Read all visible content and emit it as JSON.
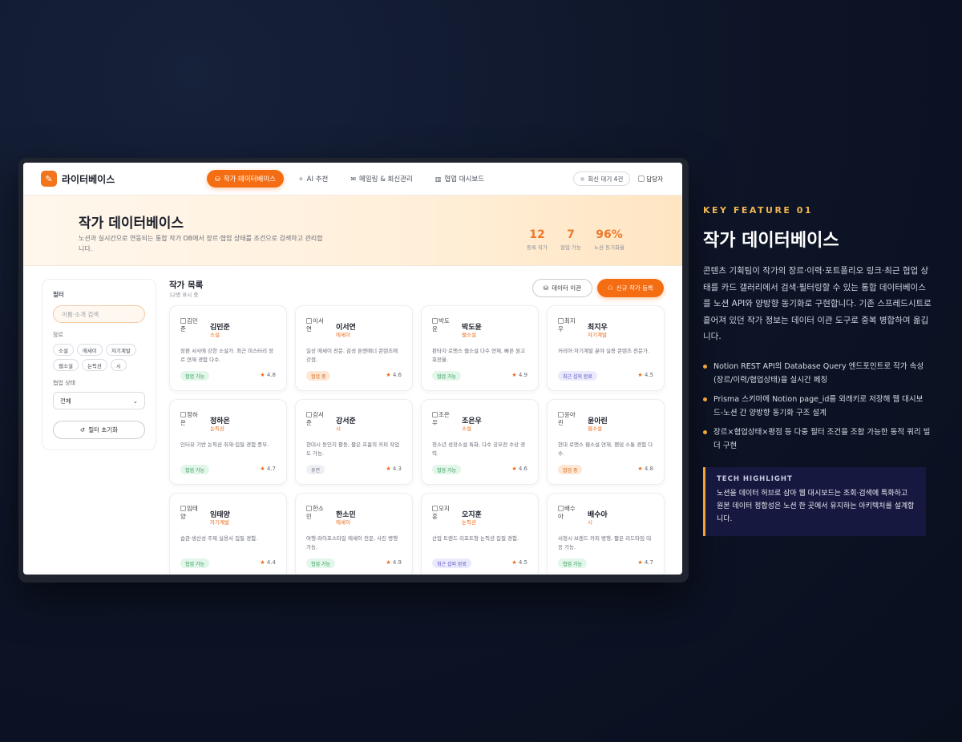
{
  "app": {
    "name": "라이터베이스"
  },
  "nav": {
    "items": [
      {
        "label": "작가 데이터베이스",
        "active": true
      },
      {
        "label": "AI 추천",
        "active": false
      },
      {
        "label": "메일링 & 회신관리",
        "active": false
      },
      {
        "label": "협업 대시보드",
        "active": false
      }
    ],
    "wait_pill": "회신 대기 4건",
    "user_alt": "담당자"
  },
  "hero": {
    "title": "작가 데이터베이스",
    "desc": "노션과 실시간으로 연동되는 통합 작가 DB에서 장르·협업 상태를 조건으로 검색하고 관리합니다.",
    "stats": [
      {
        "value": "12",
        "label": "등록 작가"
      },
      {
        "value": "7",
        "label": "협업 가능"
      },
      {
        "value": "96%",
        "label": "노션 동기화율"
      }
    ]
  },
  "filter": {
    "title": "필터",
    "search_placeholder": "이름·소개 검색",
    "genre_label": "장르",
    "genres": [
      "소설",
      "에세이",
      "자기계발",
      "웹소설",
      "논픽션",
      "시"
    ],
    "status_label": "협업 상태",
    "status_value": "전체",
    "reset_label": "필터 초기화"
  },
  "list": {
    "title": "작가 목록",
    "count": "12명 표시 중",
    "migrate_label": "데이터 이관",
    "new_label": "신규 작가 등록"
  },
  "authors": [
    {
      "alt1": "김민",
      "alt2": "준",
      "name": "김민준",
      "genre": "소설",
      "desc": "장편 서사에 강한 소설가. 최근 미스터리 장르 연재 경험 다수.",
      "status": "협업 가능",
      "badge": "green",
      "rating": "4.8"
    },
    {
      "alt1": "이서",
      "alt2": "연",
      "name": "이서연",
      "genre": "에세이",
      "desc": "일상 에세이 전문. 감성 톤앤매너 콘텐츠에 강점.",
      "status": "협업 중",
      "badge": "orange",
      "rating": "4.6"
    },
    {
      "alt1": "박도",
      "alt2": "윤",
      "name": "박도윤",
      "genre": "웹소설",
      "desc": "판타지·로맨스 웹소설 다수 연재, 빠른 원고 회전율.",
      "status": "협업 가능",
      "badge": "green",
      "rating": "4.9"
    },
    {
      "alt1": "최지",
      "alt2": "우",
      "name": "최지우",
      "genre": "자기계발",
      "desc": "커리어·자기계발 분야 실용 콘텐츠 전문가.",
      "status": "최근 섭외 완료",
      "badge": "purple",
      "rating": "4.5"
    },
    {
      "alt1": "정하",
      "alt2": "은",
      "name": "정하은",
      "genre": "논픽션",
      "desc": "인터뷰 기반 논픽션 취재·집필 경험 풍부.",
      "status": "협업 가능",
      "badge": "green",
      "rating": "4.7"
    },
    {
      "alt1": "강서",
      "alt2": "준",
      "name": "강서준",
      "genre": "시",
      "desc": "현대시 동인지 활동, 짧은 호흡의 카피 작업도 가능.",
      "status": "휴면",
      "badge": "gray",
      "rating": "4.3"
    },
    {
      "alt1": "조은",
      "alt2": "우",
      "name": "조은우",
      "genre": "소설",
      "desc": "청소년 성장소설 특화, 다수 공모전 수상 경력.",
      "status": "협업 가능",
      "badge": "green",
      "rating": "4.6"
    },
    {
      "alt1": "윤아",
      "alt2": "린",
      "name": "윤아린",
      "genre": "웹소설",
      "desc": "현대 로맨스 웹소설 연재, 팬덤 소통 경험 다수.",
      "status": "협업 중",
      "badge": "orange",
      "rating": "4.8"
    },
    {
      "alt1": "임태",
      "alt2": "양",
      "name": "임태양",
      "genre": "자기계발",
      "desc": "습관·생산성 주제 실용서 집필 경험.",
      "status": "협업 가능",
      "badge": "green",
      "rating": "4.4"
    },
    {
      "alt1": "한소",
      "alt2": "민",
      "name": "한소민",
      "genre": "에세이",
      "desc": "여행·라이프스타일 에세이 전문, 사진 병행 가능.",
      "status": "협업 가능",
      "badge": "green",
      "rating": "4.9"
    },
    {
      "alt1": "오지",
      "alt2": "훈",
      "name": "오지훈",
      "genre": "논픽션",
      "desc": "산업 트렌드 리포트형 논픽션 집필 경험.",
      "status": "최근 섭외 완료",
      "badge": "purple",
      "rating": "4.5"
    },
    {
      "alt1": "배수",
      "alt2": "아",
      "name": "배수아",
      "genre": "시",
      "desc": "서정시·브랜드 카피 병행, 짧은 리드타임 대응 가능.",
      "status": "협업 가능",
      "badge": "green",
      "rating": "4.7"
    }
  ],
  "feature": {
    "eyebrow": "KEY FEATURE 01",
    "title": "작가 데이터베이스",
    "desc": "콘텐츠 기획팀이 작가의 장르·이력·포트폴리오 링크·최근 협업 상태를 카드 갤러리에서 검색·필터링할 수 있는 통합 데이터베이스를 노션 API와 양방향 동기화로 구현합니다. 기존 스프레드시트로 흩어져 있던 작가 정보는 데이터 이관 도구로 중복 병합하여 옮깁니다.",
    "bullets": [
      "Notion REST API의 Database Query 엔드포인트로 작가 속성(장르/이력/협업상태)을 실시간 페칭",
      "Prisma 스키마에 Notion page_id를 외래키로 저장해 웹 대시보드-노션 간 양방향 동기화 구조 설계",
      "장르×협업상태×평점 등 다중 필터 조건을 조합 가능한 동적 쿼리 빌더 구현"
    ],
    "tech_title": "TECH HIGHLIGHT",
    "tech_text": "노션을 데이터 허브로 삼아 웹 대시보드는 조회·검색에 특화하고 원본 데이터 정합성은 노션 한 곳에서 유지하는 아키텍처를 설계합니다."
  }
}
